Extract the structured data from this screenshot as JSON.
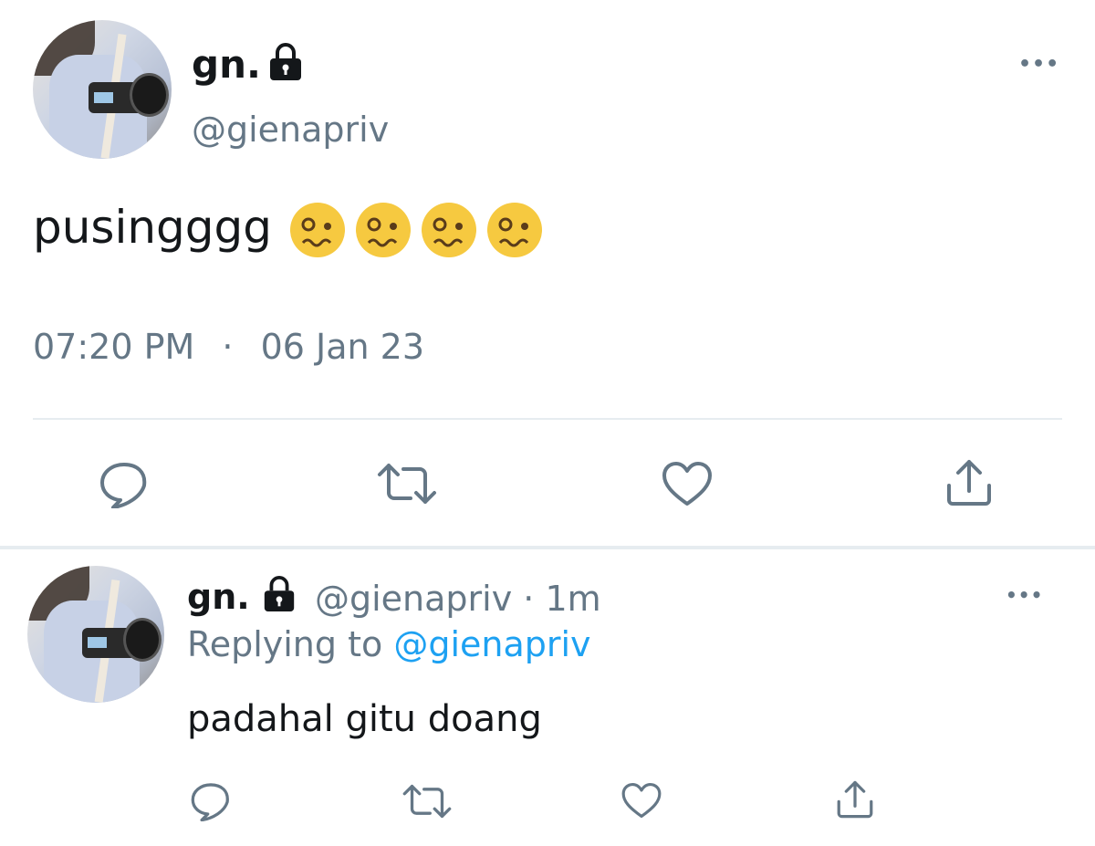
{
  "main_tweet": {
    "display_name": "gn.",
    "handle": "@gienapriv",
    "text": "pusingggg",
    "emoji_count": 4,
    "emoji_name": "woozy-face",
    "time": "07:20 PM",
    "date_separator": "·",
    "date": "06 Jan 23",
    "more_label": "•••"
  },
  "reply_tweet": {
    "display_name": "gn.",
    "handle_and_time": "@gienapriv · 1m",
    "replying_prefix": "Replying to",
    "replying_handle": "@gienapriv",
    "text": "padahal gitu doang",
    "more_label": "•••"
  },
  "icons": [
    "reply-icon",
    "retweet-icon",
    "like-icon",
    "share-icon",
    "lock-icon",
    "more-icon"
  ],
  "colors": {
    "text": "#14171a",
    "secondary": "#657786",
    "link": "#1da1f2",
    "divider": "#e6ecf0",
    "emoji": "#f6c940"
  }
}
